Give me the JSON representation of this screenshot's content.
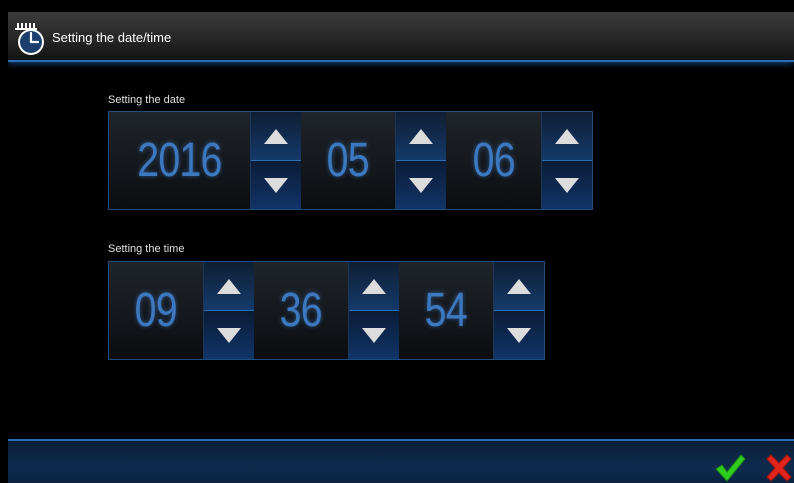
{
  "window": {
    "title": "Setting the date/time"
  },
  "date": {
    "label": "Setting the date",
    "year": "2016",
    "month": "05",
    "day": "06"
  },
  "time": {
    "label": "Setting the time",
    "hours": "09",
    "minutes": "36",
    "seconds": "54"
  },
  "icons": {
    "title": "clock-icon",
    "up": "triangle-up-icon",
    "down": "triangle-down-icon",
    "ok": "checkmark-icon",
    "cancel": "x-icon"
  },
  "colors": {
    "accent": "#2a6fb5",
    "value_text": "#3c78c0",
    "ok": "#2ecc1f",
    "cancel": "#e0241b"
  }
}
